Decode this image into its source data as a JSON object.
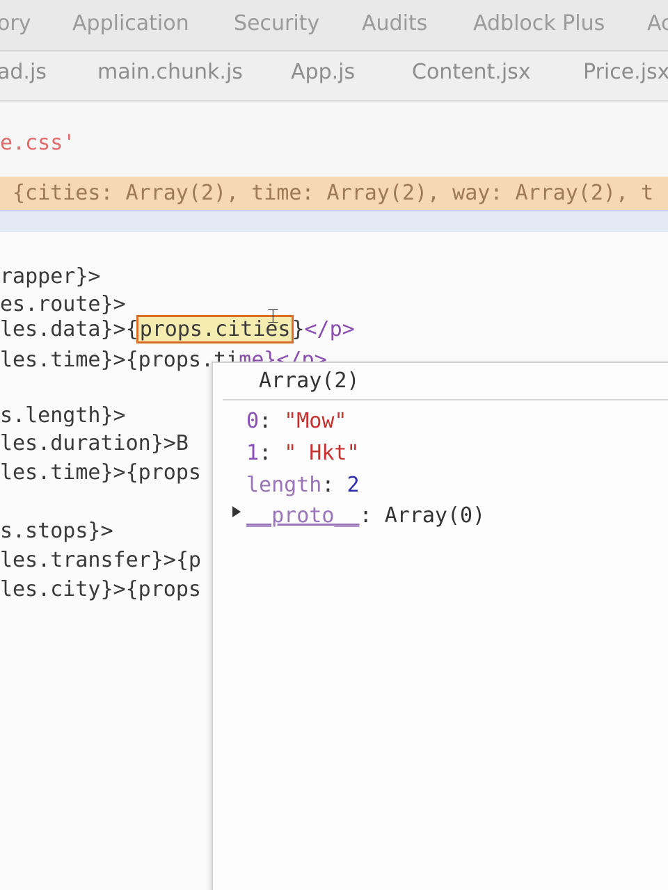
{
  "panel_tabs": [
    "ory",
    "Application",
    "Security",
    "Audits",
    "Adblock Plus",
    "Ac"
  ],
  "file_tabs": [
    "ad.js",
    "main.chunk.js",
    "App.js",
    "Content.jsx",
    "Price.jsx"
  ],
  "code": {
    "css_line": "e.css'",
    "paused_line": "{cities: Array(2), time: Array(2), way: Array(2), t",
    "lines": [
      {
        "pre": "rapper}>"
      },
      {
        "pre": "es.route}>"
      },
      {
        "pre": "les.data}>{",
        "highlight": "props.cities",
        "post": "}",
        "tag": "</p>"
      },
      {
        "pre": "les.time}>{props.ti",
        "tag": "me}</p>"
      },
      {
        "pre": ""
      },
      {
        "pre": "s.length}>"
      },
      {
        "pre": "les.duration}>B"
      },
      {
        "pre": "les.time}>{props"
      },
      {
        "pre": ""
      },
      {
        "pre": "s.stops}>"
      },
      {
        "pre": "les.transfer}>{p"
      },
      {
        "pre": "les.city}>{props"
      }
    ]
  },
  "popover": {
    "title": "Array(2)",
    "items": [
      {
        "key": "0",
        "value": "\"Mow\""
      },
      {
        "key": "1",
        "value": "\" Hkt\""
      }
    ],
    "length_key": "length",
    "length_value": "2",
    "proto_key": "__proto__",
    "proto_value": "Array(0)"
  }
}
